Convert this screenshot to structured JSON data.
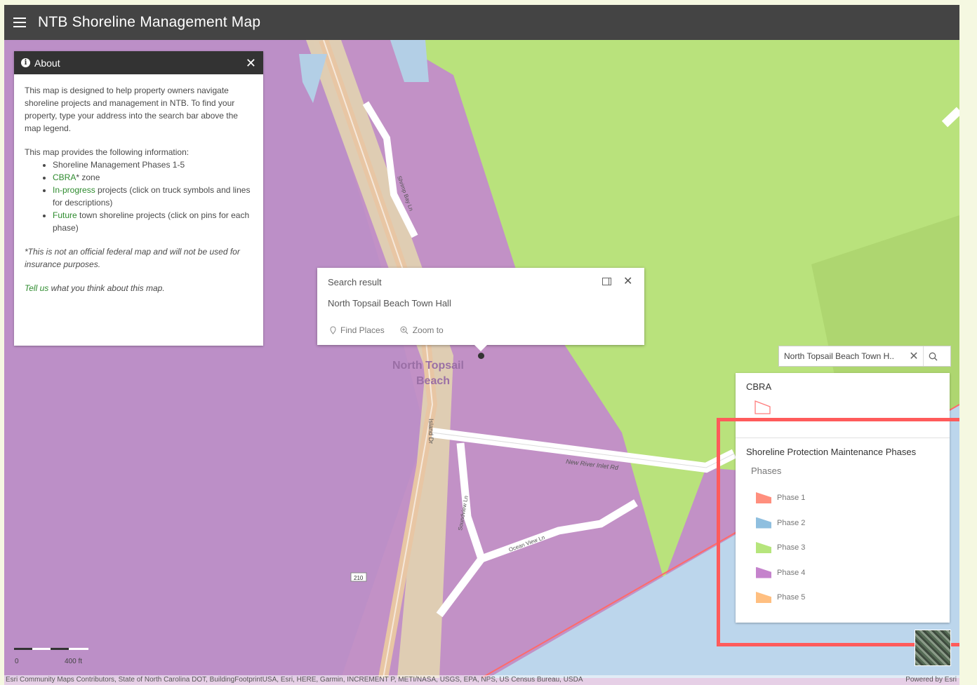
{
  "app": {
    "title": "NTB Shoreline Management Map",
    "menu_icon": "hamburger-menu-icon"
  },
  "about": {
    "title": "About",
    "intro": "This map is designed to help property owners navigate shoreline projects and management in NTB. To find your property, type your address into the search bar above the map legend.",
    "provides": "This map provides the following information:",
    "items": [
      {
        "highlight": "",
        "text": "Shoreline Management Phases 1-5"
      },
      {
        "highlight": "CBRA",
        "text": "* zone"
      },
      {
        "highlight": "In-progress",
        "text": " projects (click on truck symbols and lines for descriptions)"
      },
      {
        "highlight": "Future",
        "text": " town shoreline projects (click on pins for each phase)"
      }
    ],
    "disclaimer": "*This is not an official federal map and will not be used for insurance purposes.",
    "feedback_link": "Tell us",
    "feedback_text": " what you think about this map."
  },
  "popup": {
    "title": "Search result",
    "name": "North Topsail Beach Town Hall",
    "find_places": "Find Places",
    "zoom_to": "Zoom to"
  },
  "search": {
    "value": "North Topsail Beach Town H..",
    "clear": "✕"
  },
  "legend": {
    "cbra_title": "CBRA",
    "cbra_color": "#ff7d7d",
    "layer_title": "Shoreline Protection Maintenance Phases",
    "phases_label": "Phases",
    "phases": [
      {
        "label": "Phase 1",
        "color": "#ff8f7e"
      },
      {
        "label": "Phase 2",
        "color": "#8fbfdf"
      },
      {
        "label": "Phase 3",
        "color": "#b6e57c"
      },
      {
        "label": "Phase 4",
        "color": "#c583cc"
      },
      {
        "label": "Phase 5",
        "color": "#ffbf80"
      }
    ]
  },
  "map_labels": {
    "place_line1": "North Topsail",
    "place_line2": "Beach",
    "roads": [
      "New River Inlet Rd",
      "Island Dr",
      "Soundview Ln",
      "Ocean View Ln",
      "Shrimp Bay Ln"
    ],
    "route_shield": "210"
  },
  "scalebar": {
    "start": "0",
    "end": "400 ft"
  },
  "attribution": "Esri Community Maps Contributors, State of North Carolina DOT, BuildingFootprintUSA, Esri, HERE, Garmin, INCREMENT P, METI/NASA, USGS, EPA, NPS, US Census Bureau, USDA",
  "powered_by": "Powered by Esri"
}
